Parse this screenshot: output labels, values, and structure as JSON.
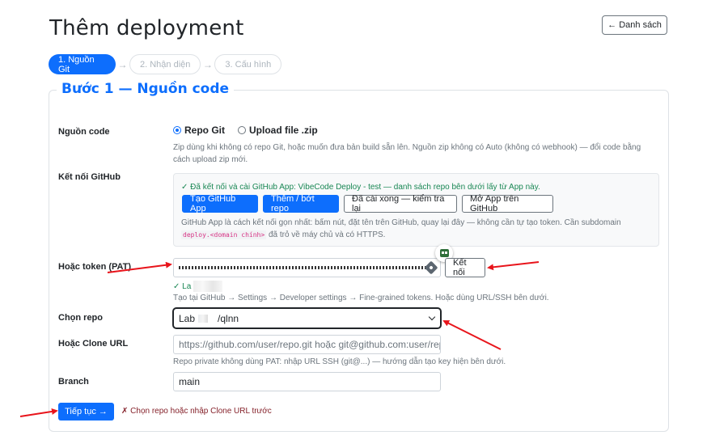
{
  "header": {
    "title": "Thêm deployment",
    "back_label": "← Danh sách"
  },
  "steps": [
    {
      "label": "1. Nguồn Git",
      "active": true
    },
    {
      "label": "2. Nhận diện",
      "active": false
    },
    {
      "label": "3. Cấu hình",
      "active": false
    }
  ],
  "step_separator": "→",
  "section": {
    "legend": "Bước 1 — Nguồn code"
  },
  "source": {
    "label": "Nguồn code",
    "option_repo": "Repo Git",
    "option_zip": "Upload file .zip",
    "selected": "Repo Git",
    "help": "Zip dùng khi không có repo Git, hoặc muốn đưa bản build sẵn lên. Nguồn zip không có Auto (không có webhook) — đổi code bằng cách upload zip mới."
  },
  "github": {
    "label": "Kết nối GitHub",
    "status": "✓ Đã kết nối và cài GitHub App: VibeCode Deploy - test — danh sách repo bên dưới lấy từ App này.",
    "btn_create": "Tạo GitHub App",
    "btn_add_remove": "Thêm / bớt repo",
    "btn_check": "Đã cài xong — kiểm tra lại",
    "btn_open": "Mở App trên GitHub",
    "help_before": "GitHub App là cách kết nối gọn nhất: bấm nút, đặt tên trên GitHub, quay lại đây — không cần tự tạo token. Cần subdomain",
    "help_code": "deploy.<domain chính>",
    "help_after": "đã trỏ về máy chủ và có HTTPS."
  },
  "token": {
    "label": "Hoặc token (PAT)",
    "connect_label": "Kết nối",
    "status_prefix": "✓ La",
    "help": "Tạo tại GitHub → Settings → Developer settings → Fine-grained tokens. Hoặc dùng URL/SSH bên dưới."
  },
  "repo": {
    "label": "Chọn repo",
    "value_prefix": "Lab",
    "value_suffix": "/qlnn"
  },
  "clone": {
    "label": "Hoặc Clone URL",
    "placeholder": "https://github.com/user/repo.git hoặc git@github.com:user/repo.git",
    "help": "Repo private không dùng PAT: nhập URL SSH (git@...) — hướng dẫn tạo key hiện bên dưới."
  },
  "branch": {
    "label": "Branch",
    "value": "main"
  },
  "footer": {
    "next_label": "Tiếp tục →",
    "warning": "✗ Chọn repo hoặc nhập Clone URL trước"
  },
  "colors": {
    "primary": "#0d6efd",
    "success": "#198754",
    "danger": "#842029",
    "annotation_arrow": "#e8141b"
  }
}
